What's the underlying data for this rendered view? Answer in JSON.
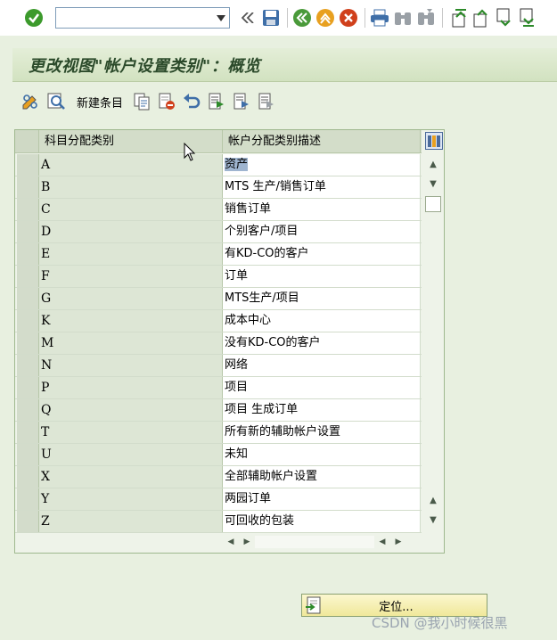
{
  "toolbar": {
    "command_field_value": "",
    "icons": [
      "enter-checkmark-icon",
      "command-dropdown-icon",
      "double-left-icon",
      "save-icon",
      "back-icon",
      "exit-icon",
      "cancel-icon",
      "print-icon",
      "find-icon",
      "find-next-icon",
      "first-page-icon",
      "previous-page-icon",
      "next-page-icon",
      "last-page-icon"
    ]
  },
  "title": "更改视图\"帐户设置类别\"：概览",
  "app_toolbar": {
    "new_entry_label": "新建条目",
    "icons": [
      "display-change-icon",
      "details-icon",
      "copy-icon",
      "delete-icon",
      "undo-icon",
      "select-all-icon",
      "select-block-icon",
      "deselect-all-icon"
    ]
  },
  "table": {
    "columns": [
      "科目分配类别",
      "帐户分配类别描述"
    ],
    "rows": [
      {
        "code": "A",
        "desc": "资产"
      },
      {
        "code": "B",
        "desc": "MTS 生产/销售订单"
      },
      {
        "code": "C",
        "desc": "销售订单"
      },
      {
        "code": "D",
        "desc": "个别客户/项目"
      },
      {
        "code": "E",
        "desc": "有KD-CO的客户"
      },
      {
        "code": "F",
        "desc": "订单"
      },
      {
        "code": "G",
        "desc": "MTS生产/项目"
      },
      {
        "code": "K",
        "desc": "成本中心"
      },
      {
        "code": "M",
        "desc": "没有KD-CO的客户"
      },
      {
        "code": "N",
        "desc": "网络"
      },
      {
        "code": "P",
        "desc": "项目"
      },
      {
        "code": "Q",
        "desc": "项目 生成订单"
      },
      {
        "code": "T",
        "desc": "所有新的辅助帐户设置"
      },
      {
        "code": "U",
        "desc": "未知"
      },
      {
        "code": "X",
        "desc": "全部辅助帐户设置"
      },
      {
        "code": "Y",
        "desc": "两园订单"
      },
      {
        "code": "Z",
        "desc": "可回收的包装"
      }
    ],
    "selected_cell": "资产"
  },
  "locate_button": {
    "label": "定位..."
  },
  "watermark": "CSDN @我小时候很黑",
  "colors": {
    "background": "#e8f0e0",
    "title_text": "#2b4a2a",
    "highlight": "#9fb5d0"
  }
}
